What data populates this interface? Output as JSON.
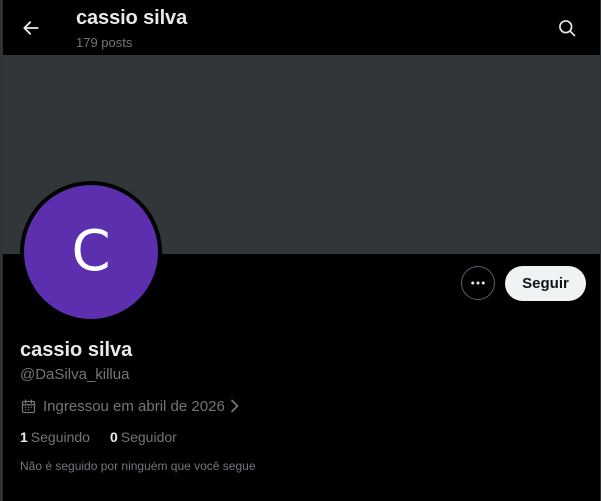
{
  "header": {
    "title": "cassio silva",
    "posts_count": "179 posts",
    "back_icon": "arrow-left-icon",
    "search_icon": "search-icon"
  },
  "banner": {
    "color": "#333639"
  },
  "avatar": {
    "letter": "C",
    "color": "#5b2fae"
  },
  "actions": {
    "more_icon": "more-horizontal-icon",
    "follow_label": "Seguir"
  },
  "profile": {
    "display_name": "cassio silva",
    "handle": "@DaSilva_killua",
    "joined": "Ingressou em abril de 2026",
    "following_count": "1",
    "following_label": "Seguindo",
    "followers_count": "0",
    "followers_label": "Seguidor",
    "not_followed_text": "Não é seguido por ninguém que você segue"
  },
  "colors": {
    "background": "#000000",
    "text_primary": "#e7e9ea",
    "text_secondary": "#71767b",
    "button_bg": "#eff3f4"
  }
}
